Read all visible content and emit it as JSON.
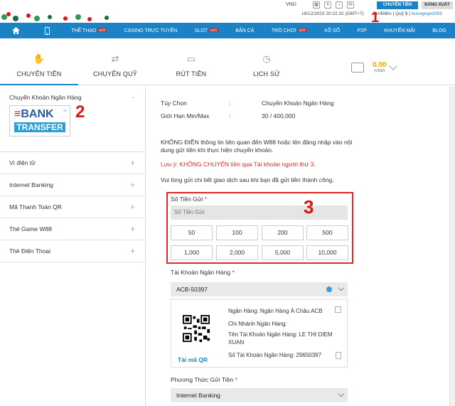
{
  "top": {
    "currency": "VND",
    "deposit_button": "CHUYỂN TIỀN",
    "logout_button": "ĐĂNG XUẤT",
    "datetime": "19/12/2023 20:22:32 (GMT+7)",
    "points_label": "DưrĐiểm",
    "fund_label": "Quỹ $",
    "username": "huongngo2005",
    "marker_1": "1"
  },
  "nav": {
    "items": [
      {
        "label": "THỂ THAO",
        "badge": "MỚI"
      },
      {
        "label": "CASINO TRỰC TUYẾN",
        "badge": ""
      },
      {
        "label": "SLOT",
        "badge": "MỚI"
      },
      {
        "label": "BẮN CÁ",
        "badge": ""
      },
      {
        "label": "TRÒ CHƠI",
        "badge": "MỚI"
      },
      {
        "label": "XỔ SỐ",
        "badge": ""
      },
      {
        "label": "P2P",
        "badge": ""
      },
      {
        "label": "KHUYẾN MÃI",
        "badge": ""
      },
      {
        "label": "BLOG",
        "badge": ""
      }
    ]
  },
  "tabs": [
    {
      "label": "CHUYỂN TIỀN",
      "icon": "hand-money-icon"
    },
    {
      "label": "CHUYỂN QUỸ",
      "icon": "transfer-fund-icon"
    },
    {
      "label": "RÚT TIỀN",
      "icon": "withdraw-icon"
    },
    {
      "label": "LỊCH SỬ",
      "icon": "history-icon"
    }
  ],
  "wallet": {
    "amount": "0.00",
    "currency": "(VND)"
  },
  "sidebar": {
    "first": {
      "label": "Chuyển Khoản Ngân Hàng",
      "toggle": "−",
      "logo_line1": "BANK",
      "logo_line2": "TRANSFER"
    },
    "marker_2": "2",
    "items": [
      {
        "label": "Ví điện tử",
        "toggle": "+"
      },
      {
        "label": "Internet Banking",
        "toggle": "+"
      },
      {
        "label": "Mã Thanh Toán QR",
        "toggle": "+"
      },
      {
        "label": "Thẻ Game W88",
        "toggle": "+"
      },
      {
        "label": "Thẻ Điện Thoại",
        "toggle": "+"
      }
    ]
  },
  "main": {
    "option_label": "Tùy Chọn",
    "option_sep": ":",
    "option_value": "Chuyển Khoản Ngân Hàng",
    "limit_label": "Giới Hạn Min/Max",
    "limit_sep": ":",
    "limit_value": "30 / 400,000",
    "note1": "KHÔNG ĐIỀN thông tin liên quan đến W88 hoặc tên đăng nhập vào nội dung gửi tiền khi thực hiện chuyển khoản.",
    "warning": "Lưu ý: KHÔNG CHUYỂN tiền qua Tài khoản người thứ 3.",
    "note2": "Vui lòng gửi chi tiết giao dịch sau khi bạn đã gửi tiền thành công.",
    "amount_label": "Số Tiền Gửi",
    "required_mark": "*",
    "amount_placeholder": "Số Tiền Gửi",
    "marker_3": "3",
    "quick_amounts": [
      "50",
      "100",
      "200",
      "500",
      "1,000",
      "2,000",
      "5,000",
      "10,000"
    ],
    "bank_account_label": "Tài Khoản Ngân Hàng",
    "bank_account_value": "ACB-50397",
    "bank_name": "Ngân Hàng: Ngân Hàng Á Châu ACB",
    "branch": "Chi Nhánh Ngân Hàng:",
    "account_name_line1": "Tên Tài Khoản Ngân Hàng: LE THI DIEM",
    "account_name_line2": "XUAN",
    "account_number": "Số Tài Khoản Ngân Hàng: 29650397",
    "qr_download": "Tải mã QR",
    "method_label": "Phương Thức Gửi Tiền",
    "method_value": "Internet Banking"
  }
}
